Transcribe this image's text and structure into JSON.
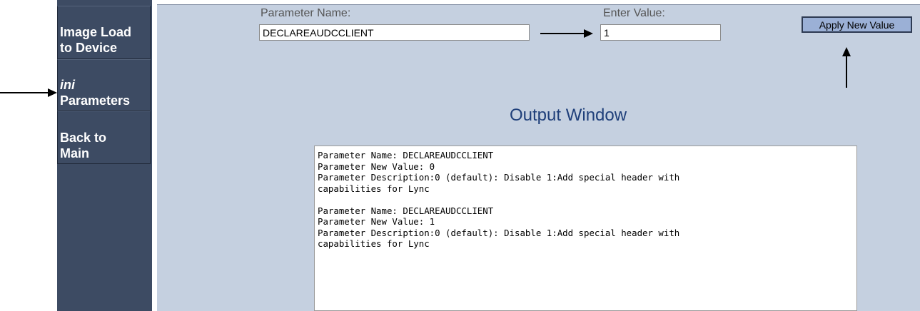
{
  "sidebar": {
    "items": [
      {
        "line1": "Image Load",
        "line2": "to Device"
      },
      {
        "line1": "ini",
        "line2": "Parameters"
      },
      {
        "line1": "Back to",
        "line2": "Main"
      }
    ]
  },
  "form": {
    "param_name_label": "Parameter Name:",
    "param_name_value": "DECLAREAUDCCLIENT",
    "enter_value_label": "Enter Value:",
    "enter_value_value": "1",
    "apply_label": "Apply New Value"
  },
  "output": {
    "title": "Output Window",
    "lines": [
      "Parameter Name: DECLAREAUDCCLIENT",
      "Parameter New Value: 0",
      "Parameter Description:0 (default): Disable 1:Add special header with",
      "capabilities for Lync",
      "",
      "Parameter Name: DECLAREAUDCCLIENT",
      "Parameter New Value: 1",
      "Parameter Description:0 (default): Disable 1:Add special header with",
      "capabilities for Lync"
    ]
  },
  "colors": {
    "sidebar": "#3d4b63",
    "main_bg": "#c5d0e0",
    "title": "#1f3f7a",
    "button": "#9bb0d6"
  }
}
